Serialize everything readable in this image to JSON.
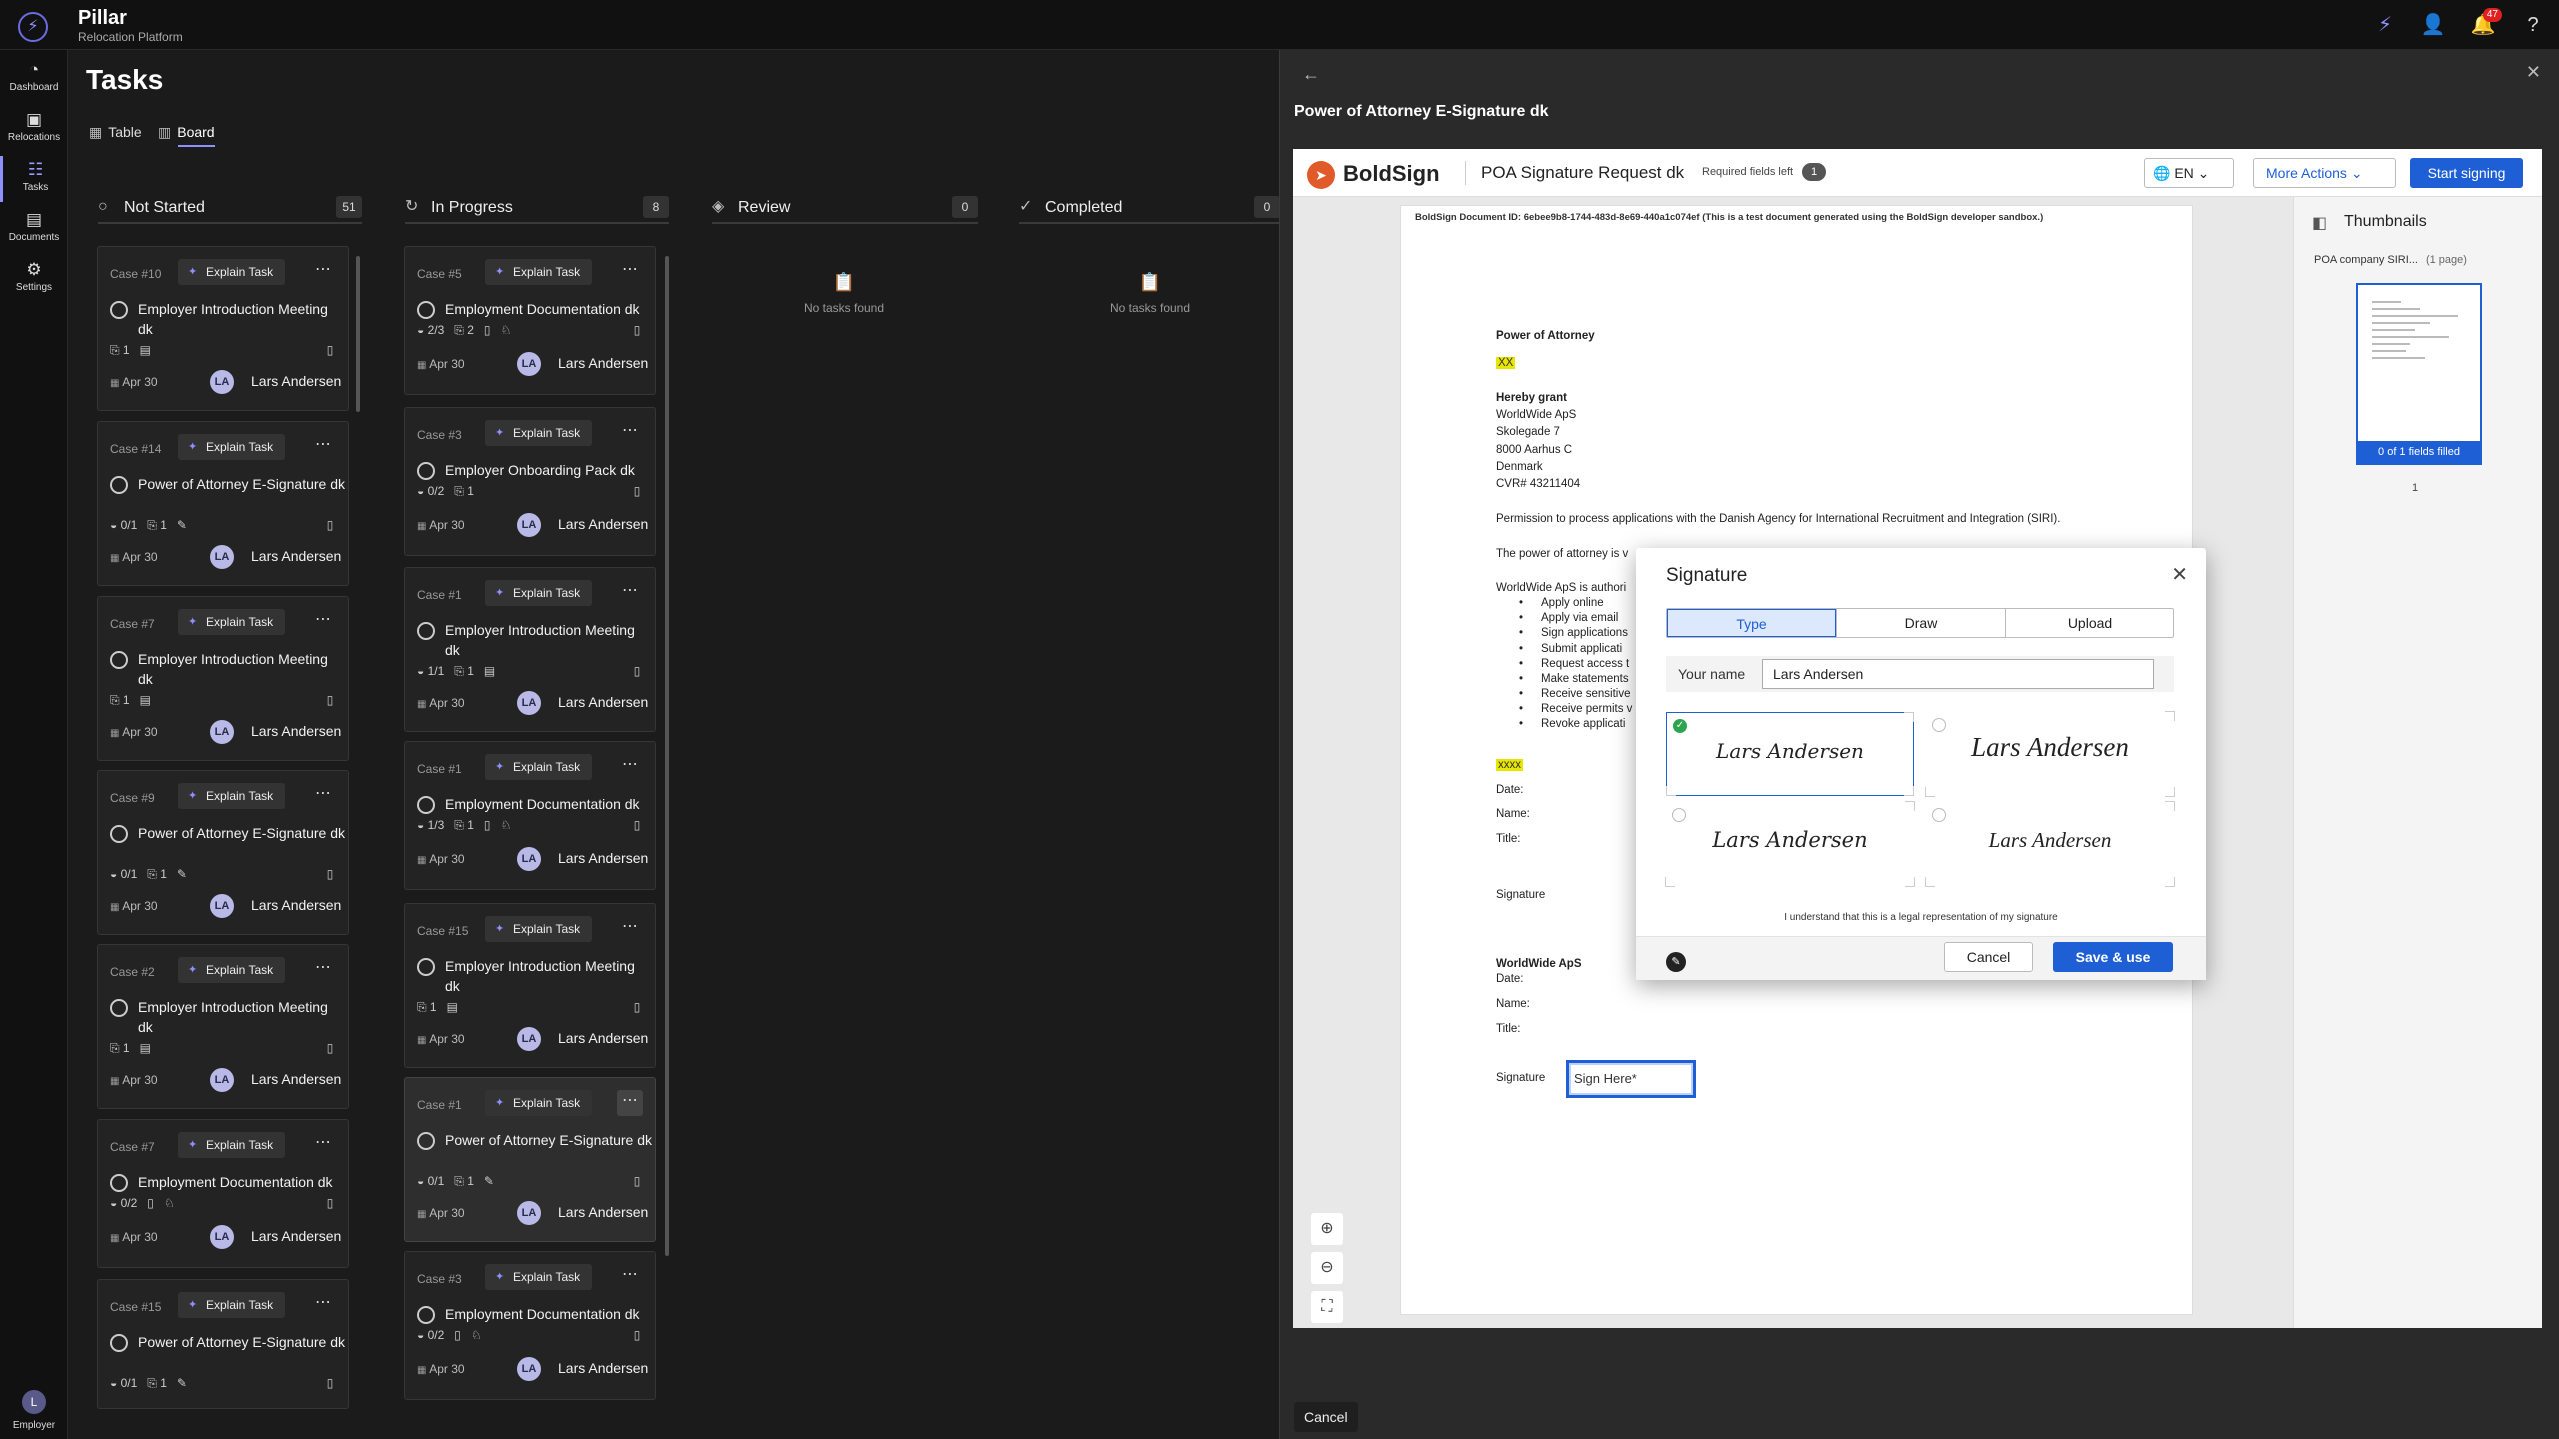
{
  "app": {
    "name": "Pillar",
    "subtitle": "Relocation Platform",
    "notifications_count": "47"
  },
  "nav": [
    {
      "label": "Dashboard",
      "icon": "dashboard-icon"
    },
    {
      "label": "Relocations",
      "icon": "briefcase-icon"
    },
    {
      "label": "Tasks",
      "icon": "tasks-icon",
      "active": true
    },
    {
      "label": "Documents",
      "icon": "document-icon"
    },
    {
      "label": "Settings",
      "icon": "gear-icon"
    }
  ],
  "user": {
    "initial": "L",
    "label": "Employer"
  },
  "page": {
    "title": "Tasks",
    "view_tabs": [
      "Table",
      "Board"
    ],
    "active_view": "Board"
  },
  "explain_label": "Explain Task",
  "columns": [
    {
      "name": "Not Started",
      "count": "51"
    },
    {
      "name": "In Progress",
      "count": "8"
    },
    {
      "name": "Review",
      "count": "0",
      "empty_text": "No tasks found"
    },
    {
      "name": "Completed",
      "count": "0",
      "empty_text": "No tasks found"
    }
  ],
  "not_started": [
    {
      "case": "Case #10",
      "title": "Employer Introduction Meeting dk",
      "meta": [
        "⎘ 1",
        "▤"
      ],
      "date": "Apr 30",
      "initials": "LA",
      "assignee": "Lars Andersen"
    },
    {
      "case": "Case #14",
      "title": "Power of Attorney E-Signature dk",
      "meta": [
        "◒ 0/1",
        "⎘ 1",
        "✎"
      ],
      "date": "Apr 30",
      "initials": "LA",
      "assignee": "Lars Andersen"
    },
    {
      "case": "Case #7",
      "title": "Employer Introduction Meeting dk",
      "meta": [
        "⎘ 1",
        "▤"
      ],
      "date": "Apr 30",
      "initials": "LA",
      "assignee": "Lars Andersen"
    },
    {
      "case": "Case #9",
      "title": "Power of Attorney E-Signature dk",
      "meta": [
        "◒ 0/1",
        "⎘ 1",
        "✎"
      ],
      "date": "Apr 30",
      "initials": "LA",
      "assignee": "Lars Andersen"
    },
    {
      "case": "Case #2",
      "title": "Employer Introduction Meeting dk",
      "meta": [
        "⎘ 1",
        "▤"
      ],
      "date": "Apr 30",
      "initials": "LA",
      "assignee": "Lars Andersen"
    },
    {
      "case": "Case #7",
      "title": "Employment Documentation dk",
      "meta": [
        "◒ 0/2",
        "▯",
        "♘"
      ],
      "date": "Apr 30",
      "initials": "LA",
      "assignee": "Lars Andersen"
    },
    {
      "case": "Case #15",
      "title": "Power of Attorney E-Signature dk",
      "meta": [
        "◒ 0/1",
        "⎘ 1",
        "✎"
      ],
      "date": "",
      "initials": "",
      "assignee": ""
    }
  ],
  "in_progress": [
    {
      "case": "Case #5",
      "title": "Employment Documentation dk",
      "meta": [
        "◒ 2/3",
        "⎘ 2",
        "▯",
        "♘"
      ],
      "date": "Apr 30",
      "initials": "LA",
      "assignee": "Lars Andersen"
    },
    {
      "case": "Case #3",
      "title": "Employer Onboarding Pack dk",
      "meta": [
        "◒ 0/2",
        "⎘ 1"
      ],
      "date": "Apr 30",
      "initials": "LA",
      "assignee": "Lars Andersen"
    },
    {
      "case": "Case #1",
      "title": "Employer Introduction Meeting dk",
      "meta": [
        "◒ 1/1",
        "⎘ 1",
        "▤"
      ],
      "date": "Apr 30",
      "initials": "LA",
      "assignee": "Lars Andersen"
    },
    {
      "case": "Case #1",
      "title": "Employment Documentation dk",
      "meta": [
        "◒ 1/3",
        "⎘ 1",
        "▯",
        "♘"
      ],
      "date": "Apr 30",
      "initials": "LA",
      "assignee": "Lars Andersen"
    },
    {
      "case": "Case #15",
      "title": "Employer Introduction Meeting dk",
      "meta": [
        "⎘ 1",
        "▤"
      ],
      "date": "Apr 30",
      "initials": "LA",
      "assignee": "Lars Andersen"
    },
    {
      "case": "Case #1",
      "title": "Power of Attorney E-Signature dk",
      "meta": [
        "◒ 0/1",
        "⎘ 1",
        "✎"
      ],
      "date": "Apr 30",
      "initials": "LA",
      "assignee": "Lars Andersen"
    },
    {
      "case": "Case #3",
      "title": "Employment Documentation dk",
      "meta": [
        "◒ 0/2",
        "▯",
        "♘"
      ],
      "date": "Apr 30",
      "initials": "LA",
      "assignee": "Lars Andersen"
    }
  ],
  "drawer": {
    "title": "Power of Attorney E-Signature dk",
    "cancel_label": "Cancel"
  },
  "boldsign": {
    "brand": "BoldSign",
    "request_title": "POA Signature Request dk",
    "required_label": "Required fields left",
    "required_count": "1",
    "lang": "EN",
    "more_actions": "More Actions",
    "start_signing": "Start signing",
    "thumbnails_title": "Thumbnails",
    "thumb_file": "POA company SIRI...",
    "thumb_pages": "(1 page)",
    "thumb_filled": "0 of 1 fields filled",
    "thumb_page_num": "1"
  },
  "document": {
    "doc_id": "BoldSign Document ID: 6ebee9b8-1744-483d-8e69-440a1c074ef (This is a test document generated using the BoldSign developer sandbox.)",
    "heading": "Power of Attorney",
    "placeholder_xx": "XX",
    "grant_heading": "Hereby grant",
    "company": "WorldWide ApS",
    "street": "Skolegade 7",
    "city": "8000 Aarhus C",
    "country": "Denmark",
    "cvr": "CVR# 43211404",
    "permission": "Permission to process applications with the Danish Agency for International Recruitment and Integration (SIRI).",
    "validity": "The power of attorney is v",
    "authorized": "WorldWide ApS is authori",
    "bullets": [
      "Apply online",
      "Apply via email",
      "Sign applications",
      "Submit applicati",
      "Request access t",
      "Make statements",
      "Receive sensitive",
      "Receive permits v",
      "Revoke applicati"
    ],
    "placeholder_xxxx": "xxxx",
    "date_label": "Date:",
    "name_label": "Name:",
    "title_label": "Title:",
    "signature_label": "Signature",
    "company_block": "WorldWide ApS",
    "sign_here": "Sign Here*"
  },
  "signature_dialog": {
    "title": "Signature",
    "tabs": [
      "Type",
      "Draw",
      "Upload"
    ],
    "active_tab": "Type",
    "name_label": "Your name",
    "name_value": "Lars Andersen",
    "options": [
      "Lars Andersen",
      "Lars Andersen",
      "Lars Andersen",
      "Lars Andersen"
    ],
    "selected_option": 0,
    "legal_text": "I understand that this is a legal representation of my signature",
    "cancel_label": "Cancel",
    "save_label": "Save & use"
  },
  "colors": {
    "accent": "#8f8fff",
    "boldsign_blue": "#1e5fd6",
    "highlight": "#e6e600",
    "notification": "#e02020"
  }
}
